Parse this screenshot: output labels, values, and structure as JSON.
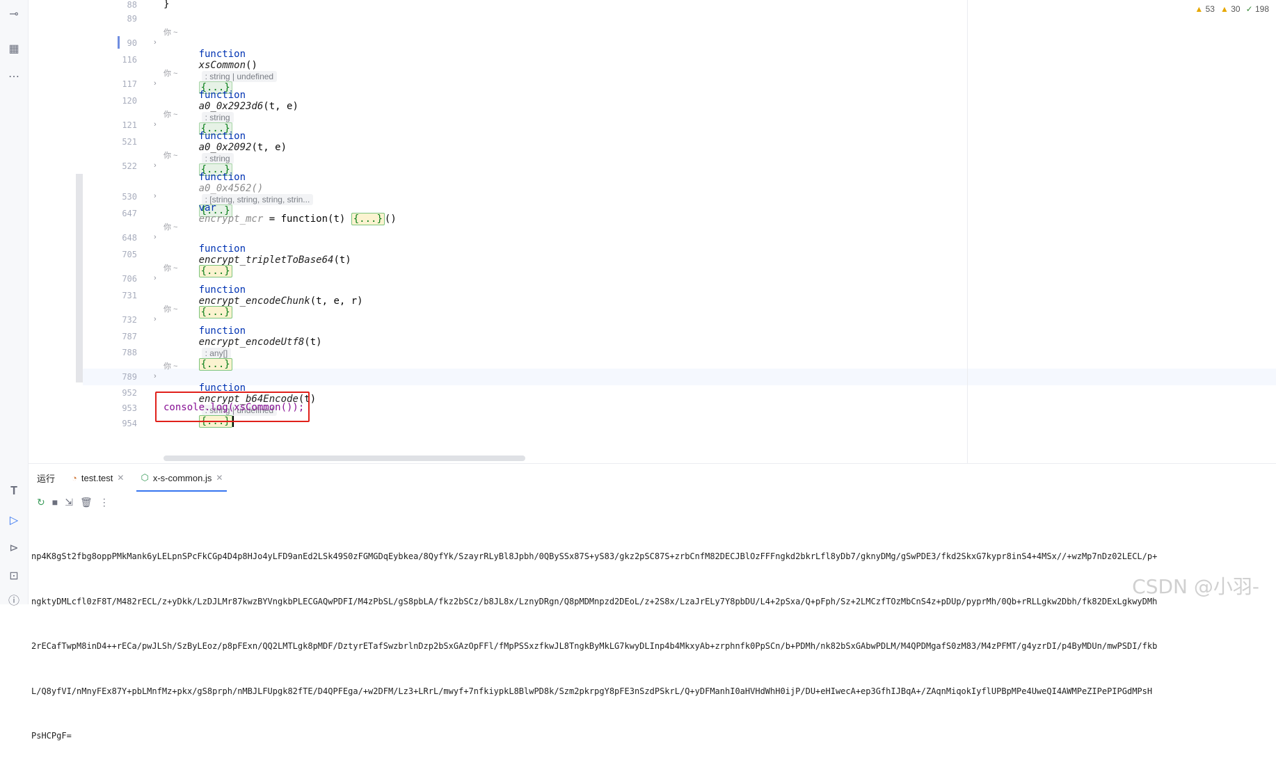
{
  "inspections": {
    "warnings": "53",
    "weak_warnings": "30",
    "ok": "198"
  },
  "code_lines": [
    {
      "ln": "88",
      "text": "}"
    },
    {
      "ln": "89",
      "text": ""
    },
    {
      "ln": "90",
      "kw": "function",
      "name": "xsCommon",
      "args": "()",
      "hint": ": string | undefined",
      "fold": "{...}"
    },
    {
      "ln": "116",
      "text": ""
    },
    {
      "ln": "117",
      "kw": "function",
      "name": "a0_0x2923d6",
      "args": "(t, e)",
      "hint": ": string",
      "fold": "{...}"
    },
    {
      "ln": "120",
      "text": ""
    },
    {
      "ln": "121",
      "kw": "function",
      "name": "a0_0x2092",
      "args": "(t, e)",
      "hint": ": string",
      "fold": "{...}"
    },
    {
      "ln": "521",
      "text": ""
    },
    {
      "ln": "522",
      "kw": "function",
      "name": "a0_0x4562",
      "args": "()",
      "hint": ": [string, string, string, strin...",
      "fold": "{...}"
    },
    {
      "ln": "530",
      "kw": "var",
      "name": "encrypt_mcr",
      "rest": " = function(t) ",
      "fold": "{...}",
      "tail": "()"
    },
    {
      "ln": "647",
      "text": ""
    },
    {
      "ln": "648",
      "kw": "function",
      "name": "encrypt_tripletToBase64",
      "args": "(t)",
      "fold": "{...}"
    },
    {
      "ln": "705",
      "text": ""
    },
    {
      "ln": "706",
      "kw": "function",
      "name": "encrypt_encodeChunk",
      "args": "(t, e, r)",
      "fold": "{...}"
    },
    {
      "ln": "731",
      "text": ""
    },
    {
      "ln": "732",
      "kw": "function",
      "name": "encrypt_encodeUtf8",
      "args": "(t)",
      "hint": ": any[]",
      "fold": "{...}"
    },
    {
      "ln": "787",
      "text": ""
    },
    {
      "ln": "788",
      "text": ""
    },
    {
      "ln": "789",
      "kw": "function",
      "name": "encrypt_b64Encode",
      "args": "(t)",
      "hint": ": string | undefined",
      "fold": "{...}"
    },
    {
      "ln": "952",
      "text": ""
    },
    {
      "ln": "953",
      "text": "console.log(xsCommon());"
    },
    {
      "ln": "954",
      "text": ""
    }
  ],
  "author_hint": "你 ~",
  "run_panel": {
    "title": "运行",
    "tabs": [
      {
        "label": "test.test"
      },
      {
        "label": "x-s-common.js"
      }
    ],
    "output": [
      "np4K8gSt2fbg8oppPMkMank6yLELpnSPcFkCGp4D4p8HJo4yLFD9anEd2LSk49S0zFGMGDqEybkea/8QyfYk/SzayrRLyBl8Jpbh/0QBySSx87S+yS83/gkz2pSC87S+zrbCnfM82DECJBlOzFFFngkd2bkrLfl8yDb7/gknyDMg/gSwPDE3/fkd2SkxG7kypr8inS4+4MSx//+wzMp7nDz02LECL/p+",
      "ngktyDMLcfl0zF8T/M482rECL/z+yDkk/LzDJLMr87kwzBYVngkbPLECGAQwPDFI/M4zPbSL/gS8pbLA/fkz2bSCz/b8JL8x/LznyDRgn/Q8pMDMnpzd2DEoL/z+2S8x/LzaJrELy7Y8pbDU/L4+2pSxa/Q+pFph/Sz+2LMCzfTOzMbCnS4z+pDUp/pyprMh/0Qb+rRLLgkw2Dbh/fk82DExLgkwyDMh",
      "2rECafTwpM8inD4++rECa/pwJLSh/SzByLEoz/p8pFExn/QQ2LMTLgk8pMDF/DztyrETafSwzbrlnDzp2bSxGAzOpFFl/fMpPSSxzfkwJL8TngkByMkLG7kwyDLInp4b4MkxyAb+zrphnfk0PpSCn/b+PDMh/nk82bSxGAbwPDLM/M4QPDMgafS0zM83/M4zPFMT/g4yzrDI/p4ByMDUn/mwPSDI/fkb",
      "L/Q8yfVI/nMnyFEx87Y+pbLMnfMz+pkx/gS8prph/nMBJLFUpgk82fTE/D4QPFEga/+w2DFM/Lz3+LRrL/mwyf+7nfkiypkL8BlwPD8k/Szm2pkrpgY8pFE3nSzdPSkrL/Q+yDFManhI0aHVHdWhH0ijP/DU+eHIwecA+ep3GfhIJBqA+/ZAqnMiqokIyflUPBpMPe4UweQI4AWMPeZIPePIPGdMPsH",
      "PsHCPgF="
    ]
  },
  "watermark": "CSDN @小羽-"
}
